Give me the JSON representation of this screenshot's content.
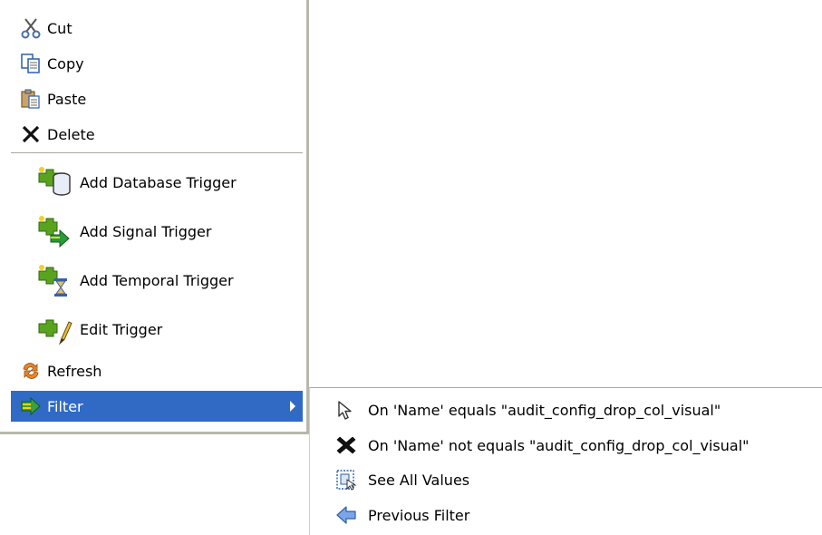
{
  "context_menu": {
    "items": [
      {
        "label": "Cut",
        "icon": "scissors-icon"
      },
      {
        "label": "Copy",
        "icon": "copy-icon"
      },
      {
        "label": "Paste",
        "icon": "paste-icon"
      },
      {
        "label": "Delete",
        "icon": "delete-x-icon"
      },
      {
        "label": "Add Database Trigger",
        "icon": "database-trigger-icon"
      },
      {
        "label": "Add Signal Trigger",
        "icon": "signal-trigger-icon"
      },
      {
        "label": "Add Temporal Trigger",
        "icon": "temporal-trigger-icon"
      },
      {
        "label": "Edit Trigger",
        "icon": "edit-trigger-icon"
      },
      {
        "label": "Refresh",
        "icon": "refresh-icon"
      },
      {
        "label": "Filter",
        "icon": "filter-icon",
        "selected": true,
        "has_submenu": true
      }
    ]
  },
  "filter_submenu": {
    "items": [
      {
        "label": "On 'Name' equals \"audit_config_drop_col_visual\"",
        "icon": "cursor-arrow-icon"
      },
      {
        "label": "On 'Name' not equals \"audit_config_drop_col_visual\"",
        "icon": "black-x-icon"
      },
      {
        "label": "See All Values",
        "icon": "see-all-values-icon"
      },
      {
        "label": "Previous Filter",
        "icon": "back-arrow-icon"
      }
    ]
  },
  "colors": {
    "selection": "#316ac5",
    "menu_background": "#ffffff",
    "separator": "#aca899"
  }
}
